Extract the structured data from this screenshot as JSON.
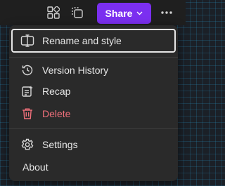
{
  "toolbar": {
    "share_label": "Share",
    "icons": [
      "apps-icon",
      "copy-icon",
      "chevron-down-icon",
      "more-options-icon"
    ]
  },
  "menu": {
    "items": [
      {
        "label": "Rename and style",
        "icon": "rename-icon"
      },
      {
        "label": "Version History",
        "icon": "history-icon"
      },
      {
        "label": "Recap",
        "icon": "recap-icon"
      },
      {
        "label": "Delete",
        "icon": "trash-icon"
      },
      {
        "label": "Settings",
        "icon": "gear-icon"
      },
      {
        "label": "About",
        "icon": ""
      }
    ]
  },
  "colors": {
    "accent": "#7b2ff0",
    "danger": "#f1707b",
    "menu_bg": "#2a2a2a",
    "text": "#e8e8e8"
  }
}
